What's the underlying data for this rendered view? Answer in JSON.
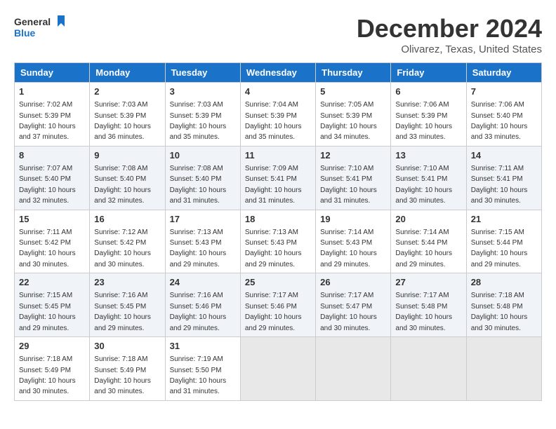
{
  "logo": {
    "line1": "General",
    "line2": "Blue"
  },
  "title": "December 2024",
  "location": "Olivarez, Texas, United States",
  "weekdays": [
    "Sunday",
    "Monday",
    "Tuesday",
    "Wednesday",
    "Thursday",
    "Friday",
    "Saturday"
  ],
  "weeks": [
    [
      {
        "day": "1",
        "sunrise": "7:02 AM",
        "sunset": "5:39 PM",
        "daylight": "10 hours and 37 minutes."
      },
      {
        "day": "2",
        "sunrise": "7:03 AM",
        "sunset": "5:39 PM",
        "daylight": "10 hours and 36 minutes."
      },
      {
        "day": "3",
        "sunrise": "7:03 AM",
        "sunset": "5:39 PM",
        "daylight": "10 hours and 35 minutes."
      },
      {
        "day": "4",
        "sunrise": "7:04 AM",
        "sunset": "5:39 PM",
        "daylight": "10 hours and 35 minutes."
      },
      {
        "day": "5",
        "sunrise": "7:05 AM",
        "sunset": "5:39 PM",
        "daylight": "10 hours and 34 minutes."
      },
      {
        "day": "6",
        "sunrise": "7:06 AM",
        "sunset": "5:39 PM",
        "daylight": "10 hours and 33 minutes."
      },
      {
        "day": "7",
        "sunrise": "7:06 AM",
        "sunset": "5:40 PM",
        "daylight": "10 hours and 33 minutes."
      }
    ],
    [
      {
        "day": "8",
        "sunrise": "7:07 AM",
        "sunset": "5:40 PM",
        "daylight": "10 hours and 32 minutes."
      },
      {
        "day": "9",
        "sunrise": "7:08 AM",
        "sunset": "5:40 PM",
        "daylight": "10 hours and 32 minutes."
      },
      {
        "day": "10",
        "sunrise": "7:08 AM",
        "sunset": "5:40 PM",
        "daylight": "10 hours and 31 minutes."
      },
      {
        "day": "11",
        "sunrise": "7:09 AM",
        "sunset": "5:41 PM",
        "daylight": "10 hours and 31 minutes."
      },
      {
        "day": "12",
        "sunrise": "7:10 AM",
        "sunset": "5:41 PM",
        "daylight": "10 hours and 31 minutes."
      },
      {
        "day": "13",
        "sunrise": "7:10 AM",
        "sunset": "5:41 PM",
        "daylight": "10 hours and 30 minutes."
      },
      {
        "day": "14",
        "sunrise": "7:11 AM",
        "sunset": "5:41 PM",
        "daylight": "10 hours and 30 minutes."
      }
    ],
    [
      {
        "day": "15",
        "sunrise": "7:11 AM",
        "sunset": "5:42 PM",
        "daylight": "10 hours and 30 minutes."
      },
      {
        "day": "16",
        "sunrise": "7:12 AM",
        "sunset": "5:42 PM",
        "daylight": "10 hours and 30 minutes."
      },
      {
        "day": "17",
        "sunrise": "7:13 AM",
        "sunset": "5:43 PM",
        "daylight": "10 hours and 29 minutes."
      },
      {
        "day": "18",
        "sunrise": "7:13 AM",
        "sunset": "5:43 PM",
        "daylight": "10 hours and 29 minutes."
      },
      {
        "day": "19",
        "sunrise": "7:14 AM",
        "sunset": "5:43 PM",
        "daylight": "10 hours and 29 minutes."
      },
      {
        "day": "20",
        "sunrise": "7:14 AM",
        "sunset": "5:44 PM",
        "daylight": "10 hours and 29 minutes."
      },
      {
        "day": "21",
        "sunrise": "7:15 AM",
        "sunset": "5:44 PM",
        "daylight": "10 hours and 29 minutes."
      }
    ],
    [
      {
        "day": "22",
        "sunrise": "7:15 AM",
        "sunset": "5:45 PM",
        "daylight": "10 hours and 29 minutes."
      },
      {
        "day": "23",
        "sunrise": "7:16 AM",
        "sunset": "5:45 PM",
        "daylight": "10 hours and 29 minutes."
      },
      {
        "day": "24",
        "sunrise": "7:16 AM",
        "sunset": "5:46 PM",
        "daylight": "10 hours and 29 minutes."
      },
      {
        "day": "25",
        "sunrise": "7:17 AM",
        "sunset": "5:46 PM",
        "daylight": "10 hours and 29 minutes."
      },
      {
        "day": "26",
        "sunrise": "7:17 AM",
        "sunset": "5:47 PM",
        "daylight": "10 hours and 30 minutes."
      },
      {
        "day": "27",
        "sunrise": "7:17 AM",
        "sunset": "5:48 PM",
        "daylight": "10 hours and 30 minutes."
      },
      {
        "day": "28",
        "sunrise": "7:18 AM",
        "sunset": "5:48 PM",
        "daylight": "10 hours and 30 minutes."
      }
    ],
    [
      {
        "day": "29",
        "sunrise": "7:18 AM",
        "sunset": "5:49 PM",
        "daylight": "10 hours and 30 minutes."
      },
      {
        "day": "30",
        "sunrise": "7:18 AM",
        "sunset": "5:49 PM",
        "daylight": "10 hours and 30 minutes."
      },
      {
        "day": "31",
        "sunrise": "7:19 AM",
        "sunset": "5:50 PM",
        "daylight": "10 hours and 31 minutes."
      },
      null,
      null,
      null,
      null
    ]
  ]
}
